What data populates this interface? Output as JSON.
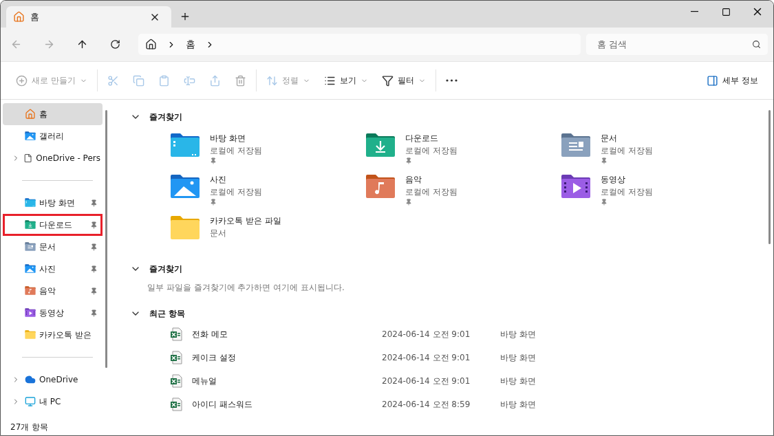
{
  "tab": {
    "title": "홈",
    "selected": true
  },
  "breadcrumb": [
    "홈"
  ],
  "search": {
    "placeholder": "홈 검색"
  },
  "toolbar": [
    {
      "kind": "new",
      "label": "새로 만들기",
      "disabled": true,
      "dropdown": true
    },
    {
      "kind": "cut",
      "disabled": true
    },
    {
      "kind": "copy",
      "disabled": true
    },
    {
      "kind": "paste",
      "disabled": true
    },
    {
      "kind": "rename",
      "disabled": true
    },
    {
      "kind": "share",
      "disabled": true
    },
    {
      "kind": "delete",
      "disabled": true
    },
    {
      "kind": "sort",
      "label": "정렬",
      "disabled": true,
      "dropdown": true
    },
    {
      "kind": "view",
      "label": "보기",
      "disabled": false,
      "dropdown": true
    },
    {
      "kind": "filter",
      "label": "필터",
      "disabled": false,
      "dropdown": true
    },
    {
      "kind": "more",
      "disabled": false
    }
  ],
  "details_button": {
    "label": "세부 정보"
  },
  "sidebar": [
    [
      {
        "label": "홈",
        "kind": "home",
        "selected": true,
        "expandable": false,
        "pinned": false,
        "highlighted": false
      },
      {
        "label": "갤러리",
        "kind": "gallery",
        "selected": false,
        "expandable": false,
        "pinned": false,
        "highlighted": false
      },
      {
        "label": "OneDrive - Pers",
        "kind": "file",
        "selected": false,
        "expandable": true,
        "pinned": false,
        "highlighted": false
      }
    ],
    [
      {
        "label": "바탕 화면",
        "kind": "desktop",
        "selected": false,
        "expandable": false,
        "pinned": true,
        "highlighted": false
      },
      {
        "label": "다운로드",
        "kind": "download",
        "selected": false,
        "expandable": false,
        "pinned": true,
        "highlighted": true
      },
      {
        "label": "문서",
        "kind": "documents",
        "selected": false,
        "expandable": false,
        "pinned": true,
        "highlighted": false
      },
      {
        "label": "사진",
        "kind": "pictures",
        "selected": false,
        "expandable": false,
        "pinned": true,
        "highlighted": false
      },
      {
        "label": "음악",
        "kind": "music",
        "selected": false,
        "expandable": false,
        "pinned": true,
        "highlighted": false
      },
      {
        "label": "동영상",
        "kind": "videos",
        "selected": false,
        "expandable": false,
        "pinned": true,
        "highlighted": false
      },
      {
        "label": "카카오톡 받은",
        "kind": "folder",
        "selected": false,
        "expandable": false,
        "pinned": false,
        "highlighted": false
      }
    ],
    [
      {
        "label": "OneDrive",
        "kind": "cloud",
        "selected": false,
        "expandable": true,
        "pinned": false,
        "highlighted": false
      },
      {
        "label": "내 PC",
        "kind": "pc",
        "selected": false,
        "expandable": true,
        "pinned": false,
        "highlighted": false
      }
    ]
  ],
  "quick_access": {
    "title": "즐겨찾기",
    "expanded": true,
    "items": [
      {
        "name": "바탕 화면",
        "subtitle": "로컬에 저장됨",
        "kind": "desktop",
        "pinned": true
      },
      {
        "name": "다운로드",
        "subtitle": "로컬에 저장됨",
        "kind": "download",
        "pinned": true
      },
      {
        "name": "문서",
        "subtitle": "로컬에 저장됨",
        "kind": "documents",
        "pinned": true
      },
      {
        "name": "사진",
        "subtitle": "로컬에 저장됨",
        "kind": "pictures",
        "pinned": true
      },
      {
        "name": "음악",
        "subtitle": "로컬에 저장됨",
        "kind": "music",
        "pinned": true
      },
      {
        "name": "동영상",
        "subtitle": "로컬에 저장됨",
        "kind": "videos",
        "pinned": true
      },
      {
        "name": "카카오톡 받은 파일",
        "subtitle": "문서",
        "kind": "folder",
        "pinned": false
      }
    ]
  },
  "favorites": {
    "title": "즐겨찾기",
    "expanded": true,
    "message": "일부 파일을 즐겨찾기에 추가하면 여기에 표시됩니다."
  },
  "recent": {
    "title": "최근 항목",
    "expanded": true,
    "rows": [
      {
        "name": "전화 메모",
        "date": "2024-06-14 오전 9:01",
        "location": "바탕 화면"
      },
      {
        "name": "케이크 설정",
        "date": "2024-06-14 오전 9:01",
        "location": "바탕 화면"
      },
      {
        "name": "메뉴얼",
        "date": "2024-06-14 오전 9:01",
        "location": "바탕 화면"
      },
      {
        "name": "아이디 패스워드",
        "date": "2024-06-14 오전 8:59",
        "location": "바탕 화면"
      }
    ]
  },
  "status_bar": {
    "text": "27개 항목"
  }
}
